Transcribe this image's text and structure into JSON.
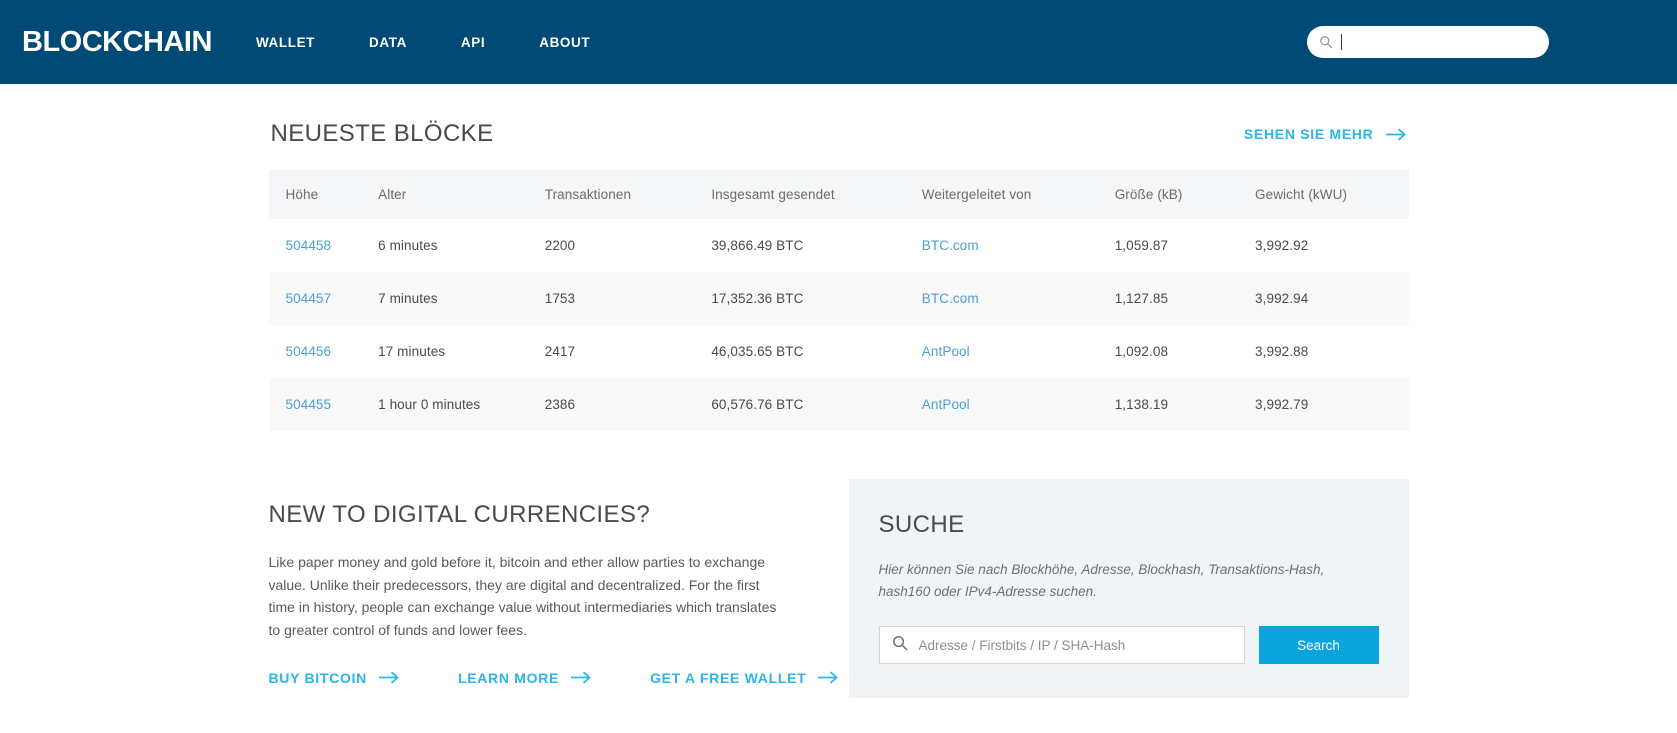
{
  "header": {
    "brand": "BLOCKCHAIN",
    "nav": [
      {
        "label": "WALLET"
      },
      {
        "label": "DATA"
      },
      {
        "label": "API"
      },
      {
        "label": "ABOUT"
      }
    ],
    "search": {
      "value": "",
      "placeholder": ""
    },
    "background_color": "#004a75"
  },
  "blocks_section": {
    "title": "NEUESTE BLÖCKE",
    "see_more_label": "SEHEN SIE MEHR",
    "columns": [
      "Höhe",
      "Alter",
      "Transaktionen",
      "Insgesamt gesendet",
      "Weitergeleitet von",
      "Größe (kB)",
      "Gewicht (kWU)"
    ],
    "rows": [
      {
        "height": "504458",
        "age": "6 minutes",
        "transactions": "2200",
        "total_sent": "39,866.49 BTC",
        "relayed_by": "BTC.com",
        "size": "1,059.87",
        "weight": "3,992.92"
      },
      {
        "height": "504457",
        "age": "7 minutes",
        "transactions": "1753",
        "total_sent": "17,352.36 BTC",
        "relayed_by": "BTC.com",
        "size": "1,127.85",
        "weight": "3,992.94"
      },
      {
        "height": "504456",
        "age": "17 minutes",
        "transactions": "2417",
        "total_sent": "46,035.65 BTC",
        "relayed_by": "AntPool",
        "size": "1,092.08",
        "weight": "3,992.88"
      },
      {
        "height": "504455",
        "age": "1 hour 0 minutes",
        "transactions": "2386",
        "total_sent": "60,576.76 BTC",
        "relayed_by": "AntPool",
        "size": "1,138.19",
        "weight": "3,992.79"
      }
    ]
  },
  "intro": {
    "title": "NEW TO DIGITAL CURRENCIES?",
    "paragraph": "Like paper money and gold before it, bitcoin and ether allow parties to exchange value. Unlike their predecessors, they are digital and decentralized. For the first time in history, people can exchange value without intermediaries which translates to greater control of funds and lower fees.",
    "ctas": [
      {
        "label": "BUY BITCOIN"
      },
      {
        "label": "LEARN MORE"
      },
      {
        "label": "GET A FREE WALLET"
      }
    ]
  },
  "search_panel": {
    "title": "SUCHE",
    "hint": "Hier können Sie nach Blockhöhe, Adresse, Blockhash, Transaktions-Hash, hash160 oder IPv4-Adresse suchen.",
    "input_value": "",
    "input_placeholder": "Adresse / Firstbits / IP / SHA-Hash",
    "button_label": "Search",
    "button_color": "#0ba5dd",
    "panel_color": "#f1f4f7"
  },
  "colors": {
    "accent_cyan": "#29b6e8",
    "link_blue": "#4a9fd0",
    "header_blue": "#004a75"
  }
}
